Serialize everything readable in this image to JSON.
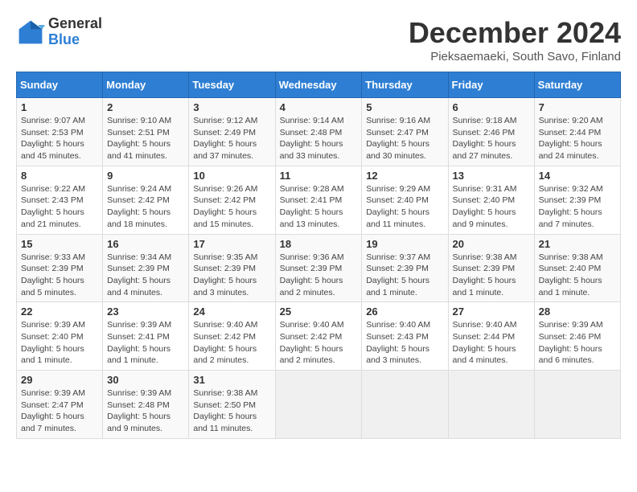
{
  "header": {
    "logo_general": "General",
    "logo_blue": "Blue",
    "title": "December 2024",
    "subtitle": "Pieksaemaeki, South Savo, Finland"
  },
  "columns": [
    "Sunday",
    "Monday",
    "Tuesday",
    "Wednesday",
    "Thursday",
    "Friday",
    "Saturday"
  ],
  "weeks": [
    [
      {
        "day": "1",
        "info": "Sunrise: 9:07 AM\nSunset: 2:53 PM\nDaylight: 5 hours\nand 45 minutes."
      },
      {
        "day": "2",
        "info": "Sunrise: 9:10 AM\nSunset: 2:51 PM\nDaylight: 5 hours\nand 41 minutes."
      },
      {
        "day": "3",
        "info": "Sunrise: 9:12 AM\nSunset: 2:49 PM\nDaylight: 5 hours\nand 37 minutes."
      },
      {
        "day": "4",
        "info": "Sunrise: 9:14 AM\nSunset: 2:48 PM\nDaylight: 5 hours\nand 33 minutes."
      },
      {
        "day": "5",
        "info": "Sunrise: 9:16 AM\nSunset: 2:47 PM\nDaylight: 5 hours\nand 30 minutes."
      },
      {
        "day": "6",
        "info": "Sunrise: 9:18 AM\nSunset: 2:46 PM\nDaylight: 5 hours\nand 27 minutes."
      },
      {
        "day": "7",
        "info": "Sunrise: 9:20 AM\nSunset: 2:44 PM\nDaylight: 5 hours\nand 24 minutes."
      }
    ],
    [
      {
        "day": "8",
        "info": "Sunrise: 9:22 AM\nSunset: 2:43 PM\nDaylight: 5 hours\nand 21 minutes."
      },
      {
        "day": "9",
        "info": "Sunrise: 9:24 AM\nSunset: 2:42 PM\nDaylight: 5 hours\nand 18 minutes."
      },
      {
        "day": "10",
        "info": "Sunrise: 9:26 AM\nSunset: 2:42 PM\nDaylight: 5 hours\nand 15 minutes."
      },
      {
        "day": "11",
        "info": "Sunrise: 9:28 AM\nSunset: 2:41 PM\nDaylight: 5 hours\nand 13 minutes."
      },
      {
        "day": "12",
        "info": "Sunrise: 9:29 AM\nSunset: 2:40 PM\nDaylight: 5 hours\nand 11 minutes."
      },
      {
        "day": "13",
        "info": "Sunrise: 9:31 AM\nSunset: 2:40 PM\nDaylight: 5 hours\nand 9 minutes."
      },
      {
        "day": "14",
        "info": "Sunrise: 9:32 AM\nSunset: 2:39 PM\nDaylight: 5 hours\nand 7 minutes."
      }
    ],
    [
      {
        "day": "15",
        "info": "Sunrise: 9:33 AM\nSunset: 2:39 PM\nDaylight: 5 hours\nand 5 minutes."
      },
      {
        "day": "16",
        "info": "Sunrise: 9:34 AM\nSunset: 2:39 PM\nDaylight: 5 hours\nand 4 minutes."
      },
      {
        "day": "17",
        "info": "Sunrise: 9:35 AM\nSunset: 2:39 PM\nDaylight: 5 hours\nand 3 minutes."
      },
      {
        "day": "18",
        "info": "Sunrise: 9:36 AM\nSunset: 2:39 PM\nDaylight: 5 hours\nand 2 minutes."
      },
      {
        "day": "19",
        "info": "Sunrise: 9:37 AM\nSunset: 2:39 PM\nDaylight: 5 hours\nand 1 minute."
      },
      {
        "day": "20",
        "info": "Sunrise: 9:38 AM\nSunset: 2:39 PM\nDaylight: 5 hours\nand 1 minute."
      },
      {
        "day": "21",
        "info": "Sunrise: 9:38 AM\nSunset: 2:40 PM\nDaylight: 5 hours\nand 1 minute."
      }
    ],
    [
      {
        "day": "22",
        "info": "Sunrise: 9:39 AM\nSunset: 2:40 PM\nDaylight: 5 hours\nand 1 minute."
      },
      {
        "day": "23",
        "info": "Sunrise: 9:39 AM\nSunset: 2:41 PM\nDaylight: 5 hours\nand 1 minute."
      },
      {
        "day": "24",
        "info": "Sunrise: 9:40 AM\nSunset: 2:42 PM\nDaylight: 5 hours\nand 2 minutes."
      },
      {
        "day": "25",
        "info": "Sunrise: 9:40 AM\nSunset: 2:42 PM\nDaylight: 5 hours\nand 2 minutes."
      },
      {
        "day": "26",
        "info": "Sunrise: 9:40 AM\nSunset: 2:43 PM\nDaylight: 5 hours\nand 3 minutes."
      },
      {
        "day": "27",
        "info": "Sunrise: 9:40 AM\nSunset: 2:44 PM\nDaylight: 5 hours\nand 4 minutes."
      },
      {
        "day": "28",
        "info": "Sunrise: 9:39 AM\nSunset: 2:46 PM\nDaylight: 5 hours\nand 6 minutes."
      }
    ],
    [
      {
        "day": "29",
        "info": "Sunrise: 9:39 AM\nSunset: 2:47 PM\nDaylight: 5 hours\nand 7 minutes."
      },
      {
        "day": "30",
        "info": "Sunrise: 9:39 AM\nSunset: 2:48 PM\nDaylight: 5 hours\nand 9 minutes."
      },
      {
        "day": "31",
        "info": "Sunrise: 9:38 AM\nSunset: 2:50 PM\nDaylight: 5 hours\nand 11 minutes."
      },
      {
        "day": "",
        "info": ""
      },
      {
        "day": "",
        "info": ""
      },
      {
        "day": "",
        "info": ""
      },
      {
        "day": "",
        "info": ""
      }
    ]
  ]
}
